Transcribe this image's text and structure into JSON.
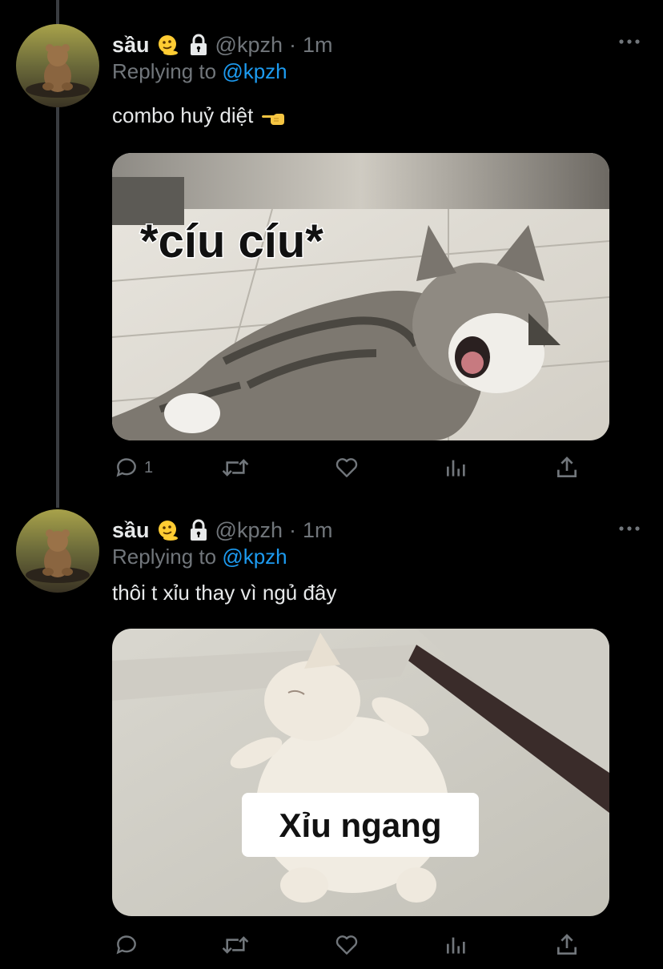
{
  "tweets": [
    {
      "name": "sầu",
      "handle": "@kpzh",
      "separator": "·",
      "time": "1m",
      "replying_prefix": "Replying to",
      "replying_to": "@kpzh",
      "text": "combo huỷ diệt",
      "text_emoji": "backhand-pointing-left-icon",
      "media_caption": "*cíu cíu*",
      "actions": {
        "reply_count": "1",
        "retweet_count": "",
        "like_count": ""
      }
    },
    {
      "name": "sầu",
      "handle": "@kpzh",
      "separator": "·",
      "time": "1m",
      "replying_prefix": "Replying to",
      "replying_to": "@kpzh",
      "text": "thôi t xỉu thay vì ngủ đây",
      "media_caption": "Xỉu ngang",
      "actions": {
        "reply_count": "",
        "retweet_count": "",
        "like_count": ""
      }
    }
  ],
  "colors": {
    "background": "#000000",
    "text": "#e7e9ea",
    "muted": "#71767b",
    "link": "#1d9bf0",
    "thread": "#3a3d41"
  }
}
